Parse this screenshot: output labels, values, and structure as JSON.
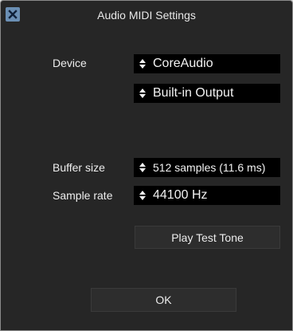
{
  "window": {
    "title": "Audio MIDI Settings",
    "close_icon": "close-x-icon"
  },
  "device": {
    "label": "Device",
    "driver": "CoreAudio",
    "output": "Built-in Output"
  },
  "buffer": {
    "label": "Buffer size",
    "value": "512 samples (11.6 ms)"
  },
  "sample_rate": {
    "label": "Sample rate",
    "value": "44100 Hz"
  },
  "buttons": {
    "test_tone": "Play Test Tone",
    "ok": "OK"
  },
  "colors": {
    "background": "#262626",
    "dropdown": "#000000",
    "button": "#2d2d2d",
    "close_button": "#6b8fb4"
  }
}
